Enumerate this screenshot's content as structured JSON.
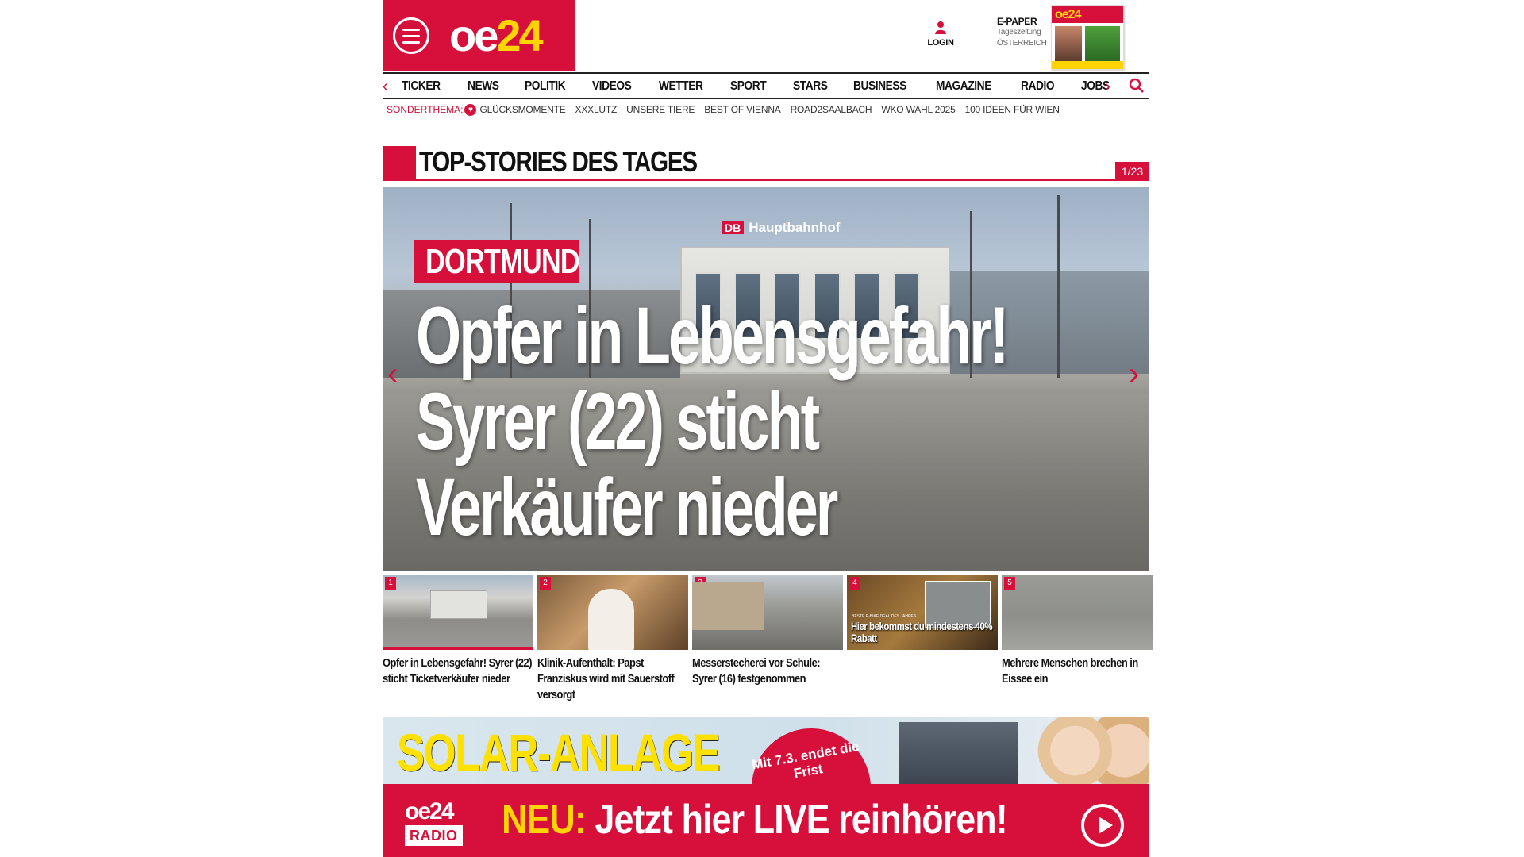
{
  "header": {
    "logo_oe": "oe",
    "logo_24": "24",
    "login_label": "LOGIN",
    "epaper": {
      "title": "E-PAPER",
      "line2": "Tageszeitung",
      "line3": "ÖSTERREICH",
      "cover_title": "oe24"
    }
  },
  "nav": {
    "items": [
      "TICKER",
      "NEWS",
      "POLITIK",
      "VIDEOS",
      "WETTER",
      "SPORT",
      "STARS",
      "BUSINESS",
      "MAGAZINE",
      "RADIO",
      "JOBS"
    ],
    "arrow_left": "‹",
    "arrow_right": "›"
  },
  "subnav": {
    "label": "SONDERTHEMA:",
    "items": [
      "GLÜCKSMOMENTE",
      "XXXLUTZ",
      "UNSERE TIERE",
      "BEST OF VIENNA",
      "ROAD2SAALBACH",
      "WKO WAHL 2025",
      "100 IDEEN FÜR WIEN"
    ]
  },
  "section": {
    "title": "TOP-STORIES DES TAGES",
    "counter": "1/23"
  },
  "hero": {
    "tag": "DORTMUND",
    "title": "Opfer in Lebensgefahr! Syrer (22) sticht Verkäufer nieder",
    "station_sign": "Hauptbahnhof",
    "station_db": "DB"
  },
  "thumbs": [
    {
      "num": "1",
      "caption": "Opfer in Lebensgefahr! Syrer (22) sticht Ticketverkäufer nieder"
    },
    {
      "num": "2",
      "caption": "Klinik-Aufenthalt: Papst Franziskus wird mit Sauerstoff versorgt"
    },
    {
      "num": "3",
      "caption": "Messerstecherei vor Schule: Syrer (16) festgenommen"
    },
    {
      "num": "4",
      "caption": "",
      "promo_small": "BESTE E-BIKE DEAL DES JAHRES",
      "promo": "Hier bekommst du mindestens 40% Rabatt"
    },
    {
      "num": "5",
      "caption": "Mehrere Menschen brechen in Eissee ein"
    }
  ],
  "ad": {
    "title": "SOLAR-ANLAGE",
    "badge": "Mit 7.3. endet die Frist"
  },
  "radio": {
    "logo_top": "oe24",
    "logo_bottom": "RADIO",
    "neu": "NEU:",
    "text": "Jetzt hier LIVE reinhören!"
  },
  "colors": {
    "brand_red": "#d6103b",
    "brand_yellow": "#ffd400"
  }
}
